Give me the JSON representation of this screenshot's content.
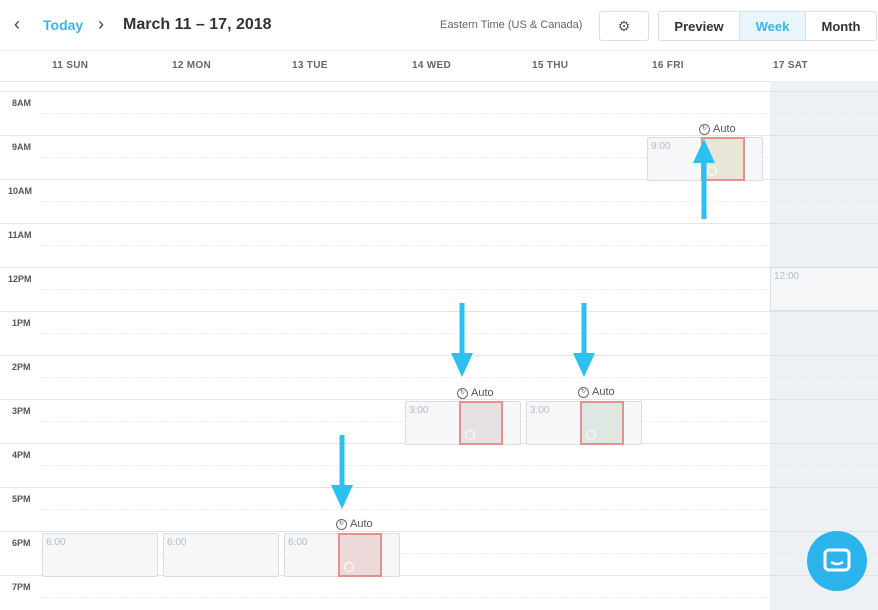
{
  "header": {
    "prev": "‹",
    "next": "›",
    "today": "Today",
    "range": "March 11 – 17, 2018",
    "timezone": "Eastern Time (US & Canada)",
    "views": [
      "Preview",
      "Week",
      "Month"
    ]
  },
  "days": [
    "11 SUN",
    "12 MON",
    "13 TUE",
    "14 WED",
    "15 THU",
    "16 FRI",
    "17 SAT"
  ],
  "hours": [
    "8AM",
    "9AM",
    "10AM",
    "11AM",
    "12PM",
    "1PM",
    "2PM",
    "3PM",
    "4PM",
    "5PM",
    "6PM",
    "7PM"
  ],
  "slots": {
    "fri": "9:00",
    "sat": "12:00",
    "wed": "3:00",
    "thu": "3:00",
    "sun": "6:00",
    "mon": "6:00",
    "tue": "6:00"
  },
  "auto_label": "Auto",
  "colors": {
    "accent": "#3ab6e8",
    "arrow": "#2bc0f0",
    "post_border": "#e88f8f"
  }
}
